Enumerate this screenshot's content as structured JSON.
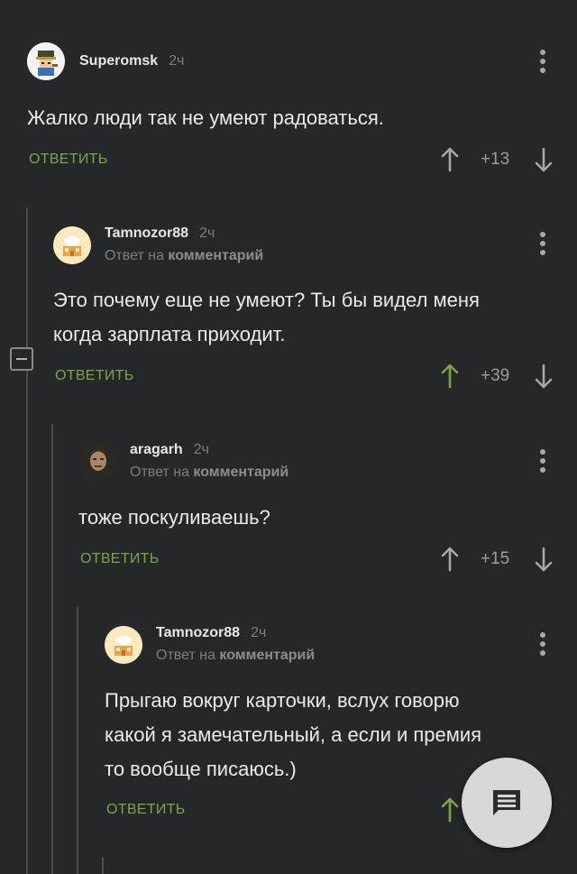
{
  "comments": [
    {
      "username": "Superomsk",
      "time": "2ч",
      "reply_prefix": "",
      "reply_target": "",
      "text_lines": [
        "Жалко люди так не умеют радоваться."
      ],
      "reply_label": "ОТВЕТИТЬ",
      "rating": "+13",
      "upvoted": false
    },
    {
      "username": "Tamnozor88",
      "time": "2ч",
      "reply_prefix": "Ответ на",
      "reply_target": "комментарий",
      "text_lines": [
        "Это почему еще не умеют? Ты бы видел меня",
        "когда зарплата приходит."
      ],
      "reply_label": "ОТВЕТИТЬ",
      "rating": "+39",
      "upvoted": true
    },
    {
      "username": "aragarh",
      "time": "2ч",
      "reply_prefix": "Ответ на",
      "reply_target": "комментарий",
      "text_lines": [
        "тоже поскуливаешь?"
      ],
      "reply_label": "ОТВЕТИТЬ",
      "rating": "+15",
      "upvoted": false
    },
    {
      "username": "Tamnozor88",
      "time": "2ч",
      "reply_prefix": "Ответ на",
      "reply_target": "комментарий",
      "text_lines": [
        "Прыгаю вокруг карточки, вслух говорю",
        "какой я замечательный, а если и премия",
        "то вообще писаюсь.)"
      ],
      "reply_label": "ОТВЕТИТЬ",
      "rating": "",
      "upvoted": true
    }
  ],
  "colors": {
    "background": "#262729",
    "accent_green": "#7ea34b",
    "muted": "#7d7e80"
  },
  "fab": {
    "icon": "comment-icon"
  }
}
